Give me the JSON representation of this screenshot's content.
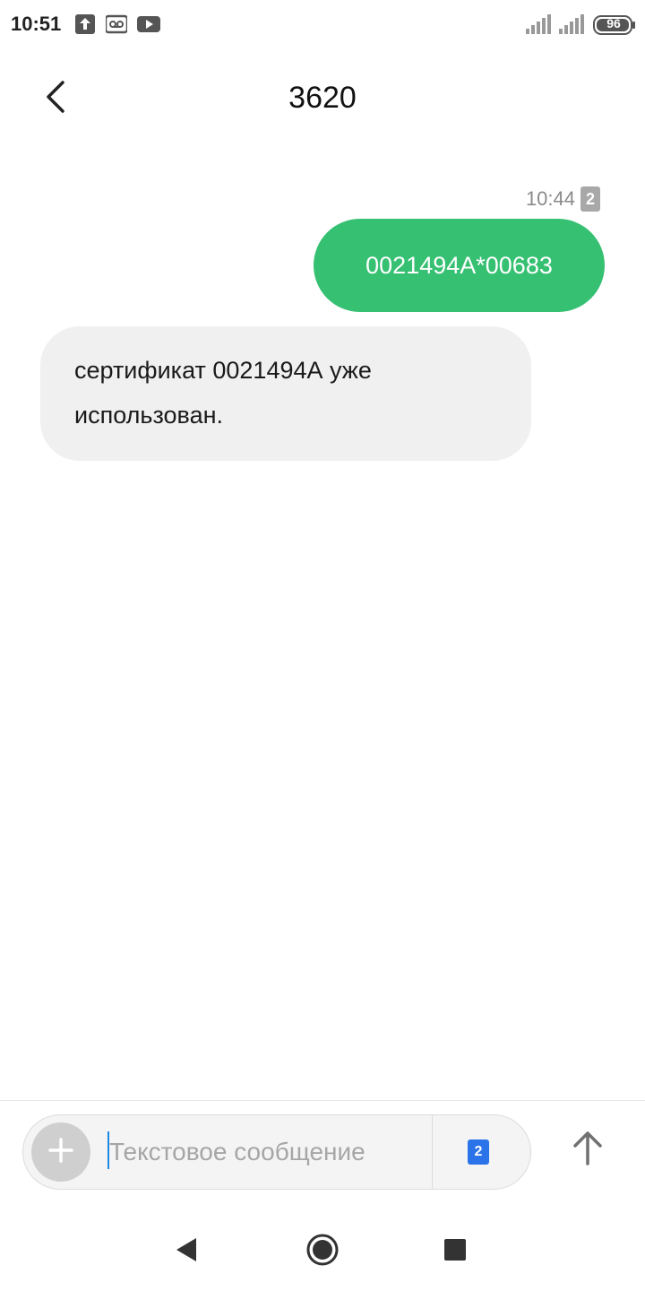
{
  "status_bar": {
    "time": "10:51",
    "battery": "96",
    "icons": [
      "upload-icon",
      "voicemail-icon",
      "youtube-icon",
      "signal-icon",
      "signal-icon",
      "battery-icon"
    ]
  },
  "header": {
    "title": "3620",
    "back_icon": "back-arrow-icon"
  },
  "messages": [
    {
      "direction": "outgoing",
      "time": "10:44",
      "sim": "2",
      "text": "0021494A*00683"
    },
    {
      "direction": "incoming",
      "text": "сертификат 0021494А уже использован."
    }
  ],
  "composer": {
    "placeholder": "Текстовое сообщение",
    "value": "",
    "sim": "2",
    "attach_icon": "plus-icon",
    "send_icon": "send-arrow-icon"
  },
  "nav": {
    "icons": [
      "back-triangle-icon",
      "home-circle-icon",
      "recents-square-icon"
    ]
  },
  "colors": {
    "outgoing_bubble": "#35c072",
    "incoming_bubble": "#f0f0f0",
    "sim_chip": "#2a73e8",
    "accent_cursor": "#1e88e5"
  }
}
